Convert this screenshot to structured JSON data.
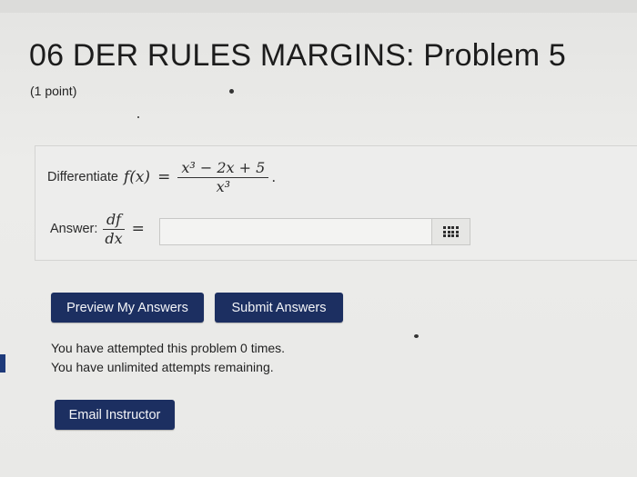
{
  "problem": {
    "title": "06 DER RULES MARGINS: Problem 5",
    "points": "(1 point)",
    "prompt_text": "Differentiate",
    "function_lhs": "f(x)",
    "equals": "=",
    "numerator": "x³ − 2x + 5",
    "denominator": "x³",
    "period": "."
  },
  "answer": {
    "label": "Answer:",
    "derivative_num": "df",
    "derivative_den": "dx",
    "equals": "=",
    "input_value": "",
    "keypad_icon": "grid-keypad-icon"
  },
  "buttons": {
    "preview": "Preview My Answers",
    "submit": "Submit Answers",
    "email": "Email Instructor"
  },
  "status": {
    "attempted": "You have attempted this problem 0 times.",
    "remaining": "You have unlimited attempts remaining."
  },
  "colors": {
    "button_bg": "#1c2f61",
    "button_text": "#f4f5f8",
    "page_bg": "#e9e9e8",
    "problem_box_bg": "#ededec"
  }
}
